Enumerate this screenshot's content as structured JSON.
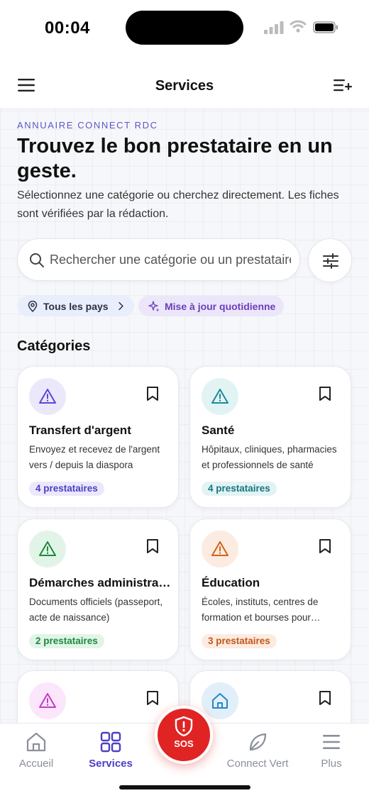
{
  "status_bar": {
    "time": "00:04"
  },
  "top_nav": {
    "title": "Services"
  },
  "hero": {
    "eyebrow": "ANNUAIRE CONNECT RDC",
    "headline": "Trouvez le bon prestataire en un geste.",
    "intro": "Sélectionnez une catégorie ou cherchez directement. Les fiches sont vérifiées par la rédaction."
  },
  "search": {
    "placeholder": "Rechercher une catégorie ou un prestataire"
  },
  "chips": {
    "country": "Tous les pays",
    "update": "Mise à jour quotidienne"
  },
  "categories": {
    "title": "Catégories",
    "items": [
      {
        "title": "Transfert d'argent",
        "description": "Envoyez et recevez de l'argent vers / depuis la diaspora",
        "count": "4 prestataires",
        "icon": "warning-icon",
        "accent": "#5b45d6",
        "bg": "#ece8fb"
      },
      {
        "title": "Santé",
        "description": "Hôpitaux, cliniques, pharmacies et professionnels de santé",
        "count": "4 prestataires",
        "icon": "warning-icon",
        "accent": "#1b8a96",
        "bg": "#e2f3f4"
      },
      {
        "title": "Démarches administratives",
        "description": "Documents officiels (passeport, acte de naissance)",
        "count": "2 prestataires",
        "icon": "warning-icon",
        "accent": "#1d8a3c",
        "bg": "#e2f4e7"
      },
      {
        "title": "Éducation",
        "description": "Écoles, instituts, centres de formation et bourses pour étudiants",
        "count": "3 prestataires",
        "icon": "warning-icon",
        "accent": "#d2621b",
        "bg": "#fcebe0"
      },
      {
        "title": "",
        "description": "",
        "count": "",
        "icon": "warning-icon",
        "accent": "#c23cc4",
        "bg": "#fbe6fb"
      },
      {
        "title": "",
        "description": "",
        "count": "",
        "icon": "home-icon",
        "accent": "#2a86c2",
        "bg": "#e1eff9"
      }
    ]
  },
  "bottom_nav": {
    "home": "Accueil",
    "services": "Services",
    "sos": "SOS",
    "green": "Connect Vert",
    "more": "Plus"
  }
}
